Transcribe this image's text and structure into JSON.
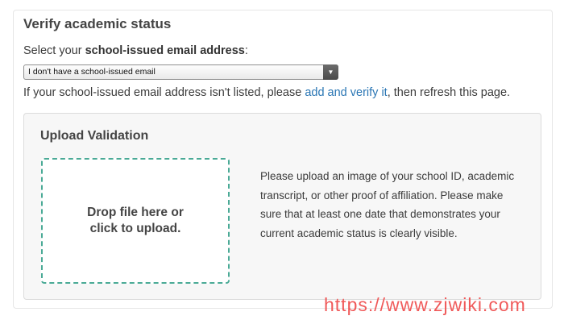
{
  "card": {
    "title": "Verify academic status",
    "select_label_prefix": "Select your ",
    "select_label_bold": "school-issued email address",
    "select_label_suffix": ":",
    "select_value": "I don't have a school-issued email",
    "hint_prefix": "If your school-issued email address isn't listed, please ",
    "hint_link": "add and verify it",
    "hint_suffix": ", then refresh this page."
  },
  "upload": {
    "title": "Upload Validation",
    "dropzone_line1": "Drop file here or",
    "dropzone_line2": "click to upload.",
    "instructions": "Please upload an image of your school ID, academic transcript, or other proof of affiliation. Please make sure that at least one date that demonstrates your current academic status is clearly visible."
  },
  "watermark": {
    "text": "https://www.zjwiki.com"
  },
  "colors": {
    "link": "#2a76b4",
    "dropzone_border": "#4aaa96",
    "watermark": "#f05a5a"
  }
}
